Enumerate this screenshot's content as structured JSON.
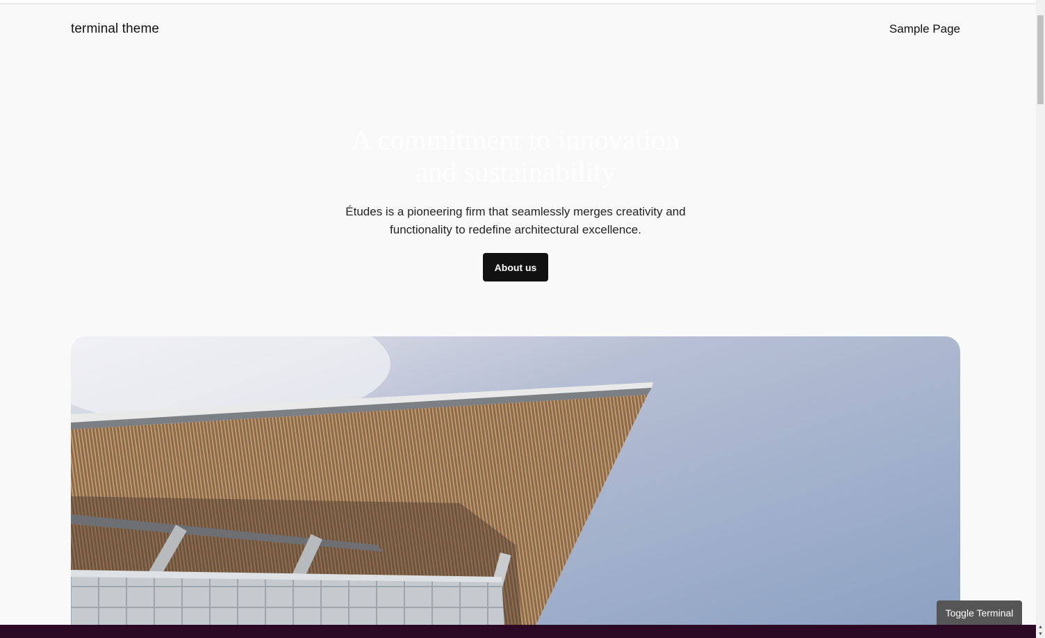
{
  "header": {
    "site_title": "terminal theme",
    "nav_items": [
      "Sample Page"
    ]
  },
  "hero": {
    "heading_line1": "A commitment to innovation",
    "heading_line2": "and sustainability",
    "text_line1": "Études is a pioneering firm that seamlessly merges creativity and",
    "text_line2": "functionality to redefine architectural excellence.",
    "button_label": "About us"
  },
  "toolbar": {
    "toggle_label": "Toggle Terminal"
  },
  "colors": {
    "page_bg": "#f9f9f9",
    "button_bg": "#111111",
    "terminal_bg": "#2c0a26",
    "toggle_bg": "#555555"
  }
}
